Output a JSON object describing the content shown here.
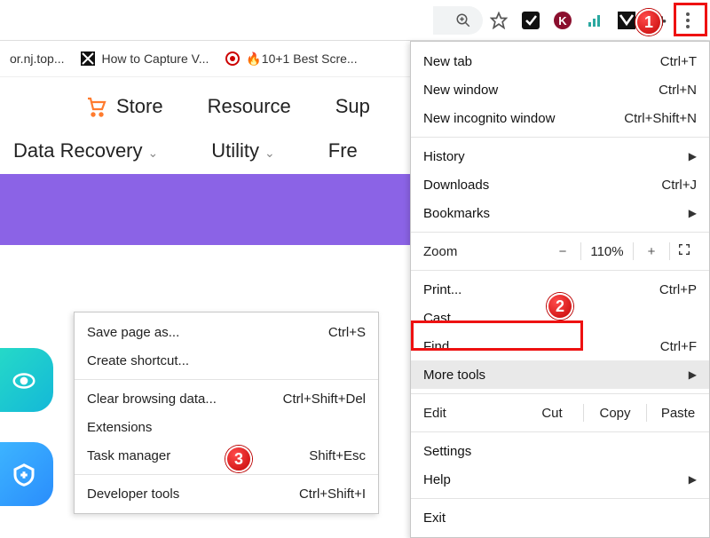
{
  "toolbar": {
    "icons": [
      "zoom-icon",
      "star-icon",
      "ext-1",
      "ext-2",
      "ext-3",
      "ext-4",
      "puzzle-icon",
      "kebab-icon"
    ]
  },
  "bookmarks": {
    "items": [
      {
        "label": "or.nj.top..."
      },
      {
        "label": "How to Capture V..."
      },
      {
        "label": "🔥10+1 Best Scre..."
      }
    ]
  },
  "site_nav1": {
    "store": "Store",
    "resource": "Resource",
    "support_partial": "Sup"
  },
  "site_nav2": {
    "data_recovery": "Data Recovery",
    "utility": "Utility",
    "free_partial": "Fre"
  },
  "menu": {
    "new_tab": {
      "label": "New tab",
      "shortcut": "Ctrl+T"
    },
    "new_win": {
      "label": "New window",
      "shortcut": "Ctrl+N"
    },
    "incog": {
      "label": "New incognito window",
      "shortcut": "Ctrl+Shift+N"
    },
    "history": {
      "label": "History"
    },
    "downloads": {
      "label": "Downloads",
      "shortcut": "Ctrl+J"
    },
    "bookmarks": {
      "label": "Bookmarks"
    },
    "zoom_label": "Zoom",
    "zoom_minus": "−",
    "zoom_val": "110%",
    "zoom_plus": "+",
    "print": {
      "label": "Print...",
      "shortcut": "Ctrl+P"
    },
    "cast": {
      "label": "Cast..."
    },
    "find": {
      "label": "Find...",
      "shortcut": "Ctrl+F"
    },
    "more_tools": {
      "label": "More tools"
    },
    "edit_label": "Edit",
    "edit_cut": "Cut",
    "edit_copy": "Copy",
    "edit_paste": "Paste",
    "settings": {
      "label": "Settings"
    },
    "help": {
      "label": "Help"
    },
    "exit": {
      "label": "Exit"
    }
  },
  "submenu": {
    "save_page": {
      "label": "Save page as...",
      "shortcut": "Ctrl+S"
    },
    "create_sc": {
      "label": "Create shortcut..."
    },
    "clear_data": {
      "label": "Clear browsing data...",
      "shortcut": "Ctrl+Shift+Del"
    },
    "extensions": {
      "label": "Extensions"
    },
    "task_mgr": {
      "label": "Task manager",
      "shortcut": "Shift+Esc"
    },
    "dev_tools": {
      "label": "Developer tools",
      "shortcut": "Ctrl+Shift+I"
    }
  },
  "badges": {
    "b1": "1",
    "b2": "2",
    "b3": "3"
  }
}
